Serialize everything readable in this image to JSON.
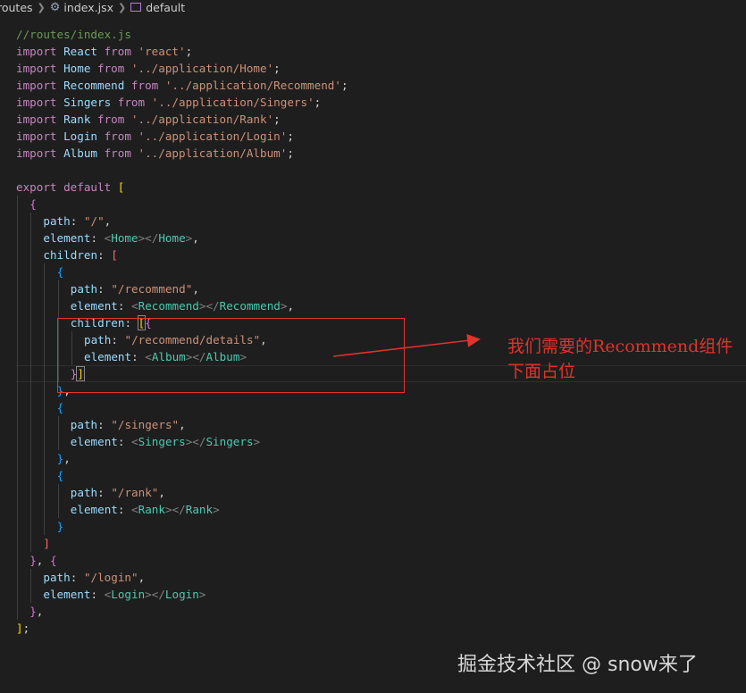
{
  "breadcrumb": {
    "folder": "routes",
    "file": "index.jsx",
    "symbol": "default"
  },
  "colors": {
    "background": "#1e1e1e",
    "comment": "#6a9955",
    "keyword": "#c586c0",
    "identifier": "#9cdcfe",
    "string": "#ce9178",
    "jsx_tag": "#4ec9b0",
    "annotation": "#e3322b"
  },
  "code_lines": [
    {
      "indent": 0,
      "tokens": [
        {
          "t": "//routes/index.js",
          "c": "comment"
        }
      ]
    },
    {
      "indent": 0,
      "tokens": [
        {
          "t": "import",
          "c": "keyword"
        },
        {
          "t": " React ",
          "c": "ident"
        },
        {
          "t": "from",
          "c": "keyword"
        },
        {
          "t": " 'react'",
          "c": "string"
        },
        {
          "t": ";",
          "c": "punct"
        }
      ]
    },
    {
      "indent": 0,
      "tokens": [
        {
          "t": "import",
          "c": "keyword"
        },
        {
          "t": " Home ",
          "c": "ident"
        },
        {
          "t": "from",
          "c": "keyword"
        },
        {
          "t": " '../application/Home'",
          "c": "string"
        },
        {
          "t": ";",
          "c": "punct"
        }
      ]
    },
    {
      "indent": 0,
      "tokens": [
        {
          "t": "import",
          "c": "keyword"
        },
        {
          "t": " Recommend ",
          "c": "ident"
        },
        {
          "t": "from",
          "c": "keyword"
        },
        {
          "t": " '../application/Recommend'",
          "c": "string"
        },
        {
          "t": ";",
          "c": "punct"
        }
      ]
    },
    {
      "indent": 0,
      "tokens": [
        {
          "t": "import",
          "c": "keyword"
        },
        {
          "t": " Singers ",
          "c": "ident"
        },
        {
          "t": "from",
          "c": "keyword"
        },
        {
          "t": " '../application/Singers'",
          "c": "string"
        },
        {
          "t": ";",
          "c": "punct"
        }
      ]
    },
    {
      "indent": 0,
      "tokens": [
        {
          "t": "import",
          "c": "keyword"
        },
        {
          "t": " Rank ",
          "c": "ident"
        },
        {
          "t": "from",
          "c": "keyword"
        },
        {
          "t": " '../application/Rank'",
          "c": "string"
        },
        {
          "t": ";",
          "c": "punct"
        }
      ]
    },
    {
      "indent": 0,
      "tokens": [
        {
          "t": "import",
          "c": "keyword"
        },
        {
          "t": " Login ",
          "c": "ident"
        },
        {
          "t": "from",
          "c": "keyword"
        },
        {
          "t": " '../application/Login'",
          "c": "string"
        },
        {
          "t": ";",
          "c": "punct"
        }
      ]
    },
    {
      "indent": 0,
      "tokens": [
        {
          "t": "import",
          "c": "keyword"
        },
        {
          "t": " Album ",
          "c": "ident"
        },
        {
          "t": "from",
          "c": "keyword"
        },
        {
          "t": " '../application/Album'",
          "c": "string"
        },
        {
          "t": ";",
          "c": "punct"
        }
      ]
    },
    {
      "indent": 0,
      "tokens": []
    },
    {
      "indent": 0,
      "tokens": [
        {
          "t": "export",
          "c": "keyword"
        },
        {
          "t": " ",
          "c": "plain"
        },
        {
          "t": "default",
          "c": "keyword"
        },
        {
          "t": " ",
          "c": "plain"
        },
        {
          "t": "[",
          "c": "bracket1"
        }
      ]
    },
    {
      "indent": 1,
      "tokens": [
        {
          "t": "{",
          "c": "bracket2"
        }
      ]
    },
    {
      "indent": 2,
      "tokens": [
        {
          "t": "path",
          "c": "ident"
        },
        {
          "t": ": ",
          "c": "punct"
        },
        {
          "t": "\"/\"",
          "c": "string"
        },
        {
          "t": ",",
          "c": "punct"
        }
      ]
    },
    {
      "indent": 2,
      "tokens": [
        {
          "t": "element",
          "c": "ident"
        },
        {
          "t": ": ",
          "c": "punct"
        },
        {
          "t": "<",
          "c": "ang"
        },
        {
          "t": "Home",
          "c": "tag"
        },
        {
          "t": "></",
          "c": "ang"
        },
        {
          "t": "Home",
          "c": "tag"
        },
        {
          "t": ">",
          "c": "ang"
        },
        {
          "t": ",",
          "c": "punct"
        }
      ]
    },
    {
      "indent": 2,
      "tokens": [
        {
          "t": "children",
          "c": "ident"
        },
        {
          "t": ": ",
          "c": "punct"
        },
        {
          "t": "[",
          "c": "bracket4"
        }
      ]
    },
    {
      "indent": 3,
      "tokens": [
        {
          "t": "{",
          "c": "bracket3"
        }
      ]
    },
    {
      "indent": 4,
      "tokens": [
        {
          "t": "path",
          "c": "ident"
        },
        {
          "t": ": ",
          "c": "punct"
        },
        {
          "t": "\"/recommend\"",
          "c": "string"
        },
        {
          "t": ",",
          "c": "punct"
        }
      ]
    },
    {
      "indent": 4,
      "tokens": [
        {
          "t": "element",
          "c": "ident"
        },
        {
          "t": ": ",
          "c": "punct"
        },
        {
          "t": "<",
          "c": "ang"
        },
        {
          "t": "Recommend",
          "c": "tag"
        },
        {
          "t": "></",
          "c": "ang"
        },
        {
          "t": "Recommend",
          "c": "tag"
        },
        {
          "t": ">",
          "c": "ang"
        },
        {
          "t": ",",
          "c": "punct"
        }
      ]
    },
    {
      "indent": 4,
      "tokens": [
        {
          "t": "children",
          "c": "ident"
        },
        {
          "t": ": ",
          "c": "punct"
        },
        {
          "t": "[",
          "c": "bracket1",
          "m": true
        },
        {
          "t": "{",
          "c": "bracket2"
        }
      ]
    },
    {
      "indent": 5,
      "tokens": [
        {
          "t": "path",
          "c": "ident"
        },
        {
          "t": ": ",
          "c": "punct"
        },
        {
          "t": "\"/recommend/details\"",
          "c": "string"
        },
        {
          "t": ",",
          "c": "punct"
        }
      ]
    },
    {
      "indent": 5,
      "tokens": [
        {
          "t": "element",
          "c": "ident"
        },
        {
          "t": ": ",
          "c": "punct"
        },
        {
          "t": "<",
          "c": "ang"
        },
        {
          "t": "Album",
          "c": "tag"
        },
        {
          "t": "></",
          "c": "ang"
        },
        {
          "t": "Album",
          "c": "tag"
        },
        {
          "t": ">",
          "c": "ang"
        }
      ]
    },
    {
      "indent": 4,
      "current": true,
      "tokens": [
        {
          "t": "}",
          "c": "bracket2"
        },
        {
          "t": "]",
          "c": "bracket1",
          "m": true
        }
      ]
    },
    {
      "indent": 3,
      "tokens": [
        {
          "t": "}",
          "c": "bracket3"
        },
        {
          "t": ",",
          "c": "punct"
        }
      ]
    },
    {
      "indent": 3,
      "tokens": [
        {
          "t": "{",
          "c": "bracket3"
        }
      ]
    },
    {
      "indent": 4,
      "tokens": [
        {
          "t": "path",
          "c": "ident"
        },
        {
          "t": ": ",
          "c": "punct"
        },
        {
          "t": "\"/singers\"",
          "c": "string"
        },
        {
          "t": ",",
          "c": "punct"
        }
      ]
    },
    {
      "indent": 4,
      "tokens": [
        {
          "t": "element",
          "c": "ident"
        },
        {
          "t": ": ",
          "c": "punct"
        },
        {
          "t": "<",
          "c": "ang"
        },
        {
          "t": "Singers",
          "c": "tag"
        },
        {
          "t": "></",
          "c": "ang"
        },
        {
          "t": "Singers",
          "c": "tag"
        },
        {
          "t": ">",
          "c": "ang"
        }
      ]
    },
    {
      "indent": 3,
      "tokens": [
        {
          "t": "}",
          "c": "bracket3"
        },
        {
          "t": ",",
          "c": "punct"
        }
      ]
    },
    {
      "indent": 3,
      "tokens": [
        {
          "t": "{",
          "c": "bracket3"
        }
      ]
    },
    {
      "indent": 4,
      "tokens": [
        {
          "t": "path",
          "c": "ident"
        },
        {
          "t": ": ",
          "c": "punct"
        },
        {
          "t": "\"/rank\"",
          "c": "string"
        },
        {
          "t": ",",
          "c": "punct"
        }
      ]
    },
    {
      "indent": 4,
      "tokens": [
        {
          "t": "element",
          "c": "ident"
        },
        {
          "t": ": ",
          "c": "punct"
        },
        {
          "t": "<",
          "c": "ang"
        },
        {
          "t": "Rank",
          "c": "tag"
        },
        {
          "t": "></",
          "c": "ang"
        },
        {
          "t": "Rank",
          "c": "tag"
        },
        {
          "t": ">",
          "c": "ang"
        }
      ]
    },
    {
      "indent": 3,
      "tokens": [
        {
          "t": "}",
          "c": "bracket3"
        }
      ]
    },
    {
      "indent": 2,
      "tokens": [
        {
          "t": "]",
          "c": "bracket4"
        }
      ]
    },
    {
      "indent": 1,
      "tokens": [
        {
          "t": "}",
          "c": "bracket2"
        },
        {
          "t": ", ",
          "c": "punct"
        },
        {
          "t": "{",
          "c": "bracket2"
        }
      ]
    },
    {
      "indent": 2,
      "tokens": [
        {
          "t": "path",
          "c": "ident"
        },
        {
          "t": ": ",
          "c": "punct"
        },
        {
          "t": "\"/login\"",
          "c": "string"
        },
        {
          "t": ",",
          "c": "punct"
        }
      ]
    },
    {
      "indent": 2,
      "tokens": [
        {
          "t": "element",
          "c": "ident"
        },
        {
          "t": ": ",
          "c": "punct"
        },
        {
          "t": "<",
          "c": "ang"
        },
        {
          "t": "Login",
          "c": "tag"
        },
        {
          "t": "></",
          "c": "ang"
        },
        {
          "t": "Login",
          "c": "tag"
        },
        {
          "t": ">",
          "c": "ang"
        }
      ]
    },
    {
      "indent": 1,
      "tokens": [
        {
          "t": "}",
          "c": "bracket2"
        },
        {
          "t": ",",
          "c": "punct"
        }
      ]
    },
    {
      "indent": 0,
      "tokens": [
        {
          "t": "]",
          "c": "bracket1"
        },
        {
          "t": ";",
          "c": "punct"
        }
      ]
    }
  ],
  "annotation": {
    "text": "我们需要的Recommend组件下面占位"
  },
  "watermark": {
    "text": "掘金技术社区 @ snow来了"
  }
}
